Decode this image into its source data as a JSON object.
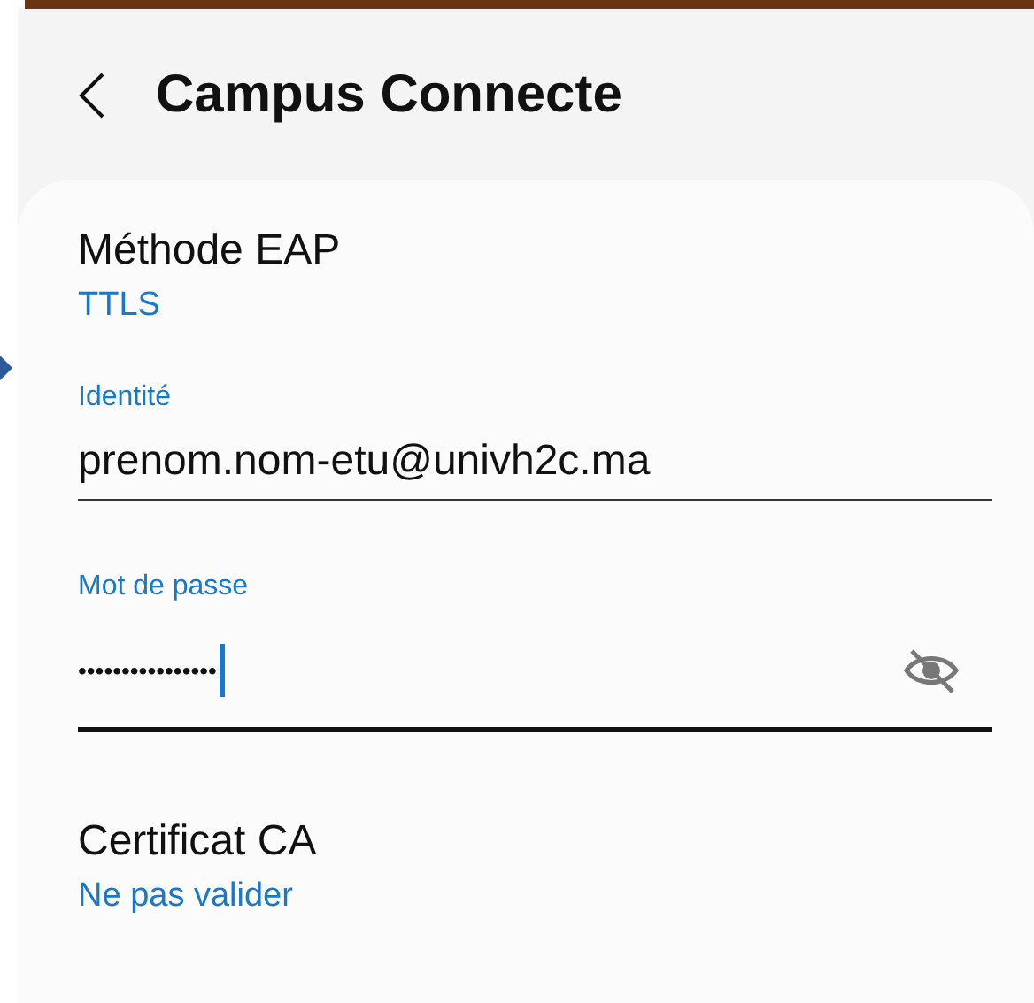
{
  "header": {
    "title": "Campus Connecte"
  },
  "settings": [
    {
      "kind": "option",
      "label": "Méthode EAP",
      "value": "TTLS"
    },
    {
      "kind": "field",
      "label": "Identité",
      "value": "prenom.nom-etu@univh2c.ma",
      "focused": false,
      "masked": false
    },
    {
      "kind": "field",
      "label": "Mot de passe",
      "value": "••••••••••••••••",
      "focused": true,
      "masked": true
    },
    {
      "kind": "option",
      "label": "Certificat CA",
      "value": "Ne pas valider"
    }
  ]
}
